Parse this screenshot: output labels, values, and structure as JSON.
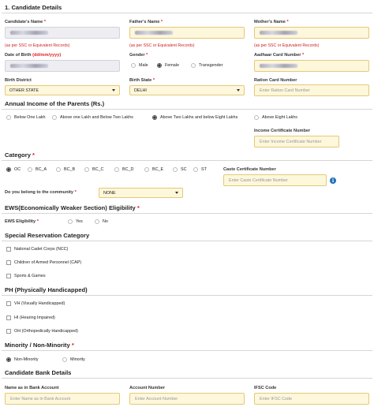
{
  "candidate": {
    "section_title": "1. Candidate Details",
    "name_label": "Candidate's Name",
    "father_label": "Father's Name",
    "mother_label": "Mother's Name",
    "ssc_note": "(as per SSC or Equivalent Records)",
    "dob_label": "Date of Birth",
    "dob_format": "(dd/mm/yyyy)",
    "gender_label": "Gender",
    "gender_options": [
      "Male",
      "Female",
      "Transgender"
    ],
    "gender_selected": "Female",
    "aadhaar_label": "Aadhaar Card Number",
    "birth_district_label": "Birth District",
    "birth_district_value": "OTHER STATE",
    "birth_state_label": "Birth State",
    "birth_state_value": "DELHI",
    "ration_label": "Ration Card Number",
    "ration_placeholder": "Enter Ration Card Number"
  },
  "income": {
    "title": "Annual Income of the Parents (Rs.)",
    "options": [
      "Below One Lakh",
      "Above one Lakh and Below Two Lakhs",
      "Above Two Lakhs and below Eight Lakhs",
      "Above Eight Lakhs"
    ],
    "selected": "Above Two Lakhs and below Eight Lakhs",
    "certificate_label": "Income Certificate Number",
    "certificate_placeholder": "Enter Income Certificate Number"
  },
  "category": {
    "title": "Category",
    "options": [
      "OC",
      "BC_A",
      "BC_B",
      "BC_C",
      "BC_D",
      "BC_E",
      "SC",
      "ST"
    ],
    "selected": "OC",
    "caste_label": "Caste Certificate Number",
    "caste_placeholder": "Enter Caste Certificate Number",
    "community_label": "Do you belong to the community",
    "community_value": "NONE",
    "info_glyph": "i"
  },
  "ews": {
    "title": "EWS(Economically Weaker Section) Eligibility",
    "label": "EWS Eligibility",
    "options": [
      "Yes",
      "No"
    ]
  },
  "special": {
    "title": "Special Reservation Category",
    "items": [
      "National Cadet Corps (NCC)",
      "Children of Armed Personnel (CAP)",
      "Sports & Games"
    ]
  },
  "ph": {
    "title": "PH (Physically Handicapped)",
    "items": [
      "VH (Visually Handicapped)",
      "HI (Hearing Impaired)",
      "OH (Orthopedically Handicapped)"
    ]
  },
  "minority": {
    "title": "Minority / Non-Minority",
    "options": [
      "Non-Minority",
      "Minority"
    ],
    "selected": "Non-Minority"
  },
  "bank": {
    "title": "Candidate Bank Details",
    "name_label": "Name as in Bank Account",
    "name_placeholder": "Enter Name as in Bank Account",
    "account_label": "Account Number",
    "account_placeholder": "Enter Account Number",
    "ifsc_label": "IFSC Code",
    "ifsc_placeholder": "Enter IFSC Code"
  },
  "required_mark": "*",
  "colors": {
    "field_bg": "#fdf7dc",
    "field_border": "#e6c877",
    "required": "#e02020",
    "info": "#1f6fb8"
  }
}
